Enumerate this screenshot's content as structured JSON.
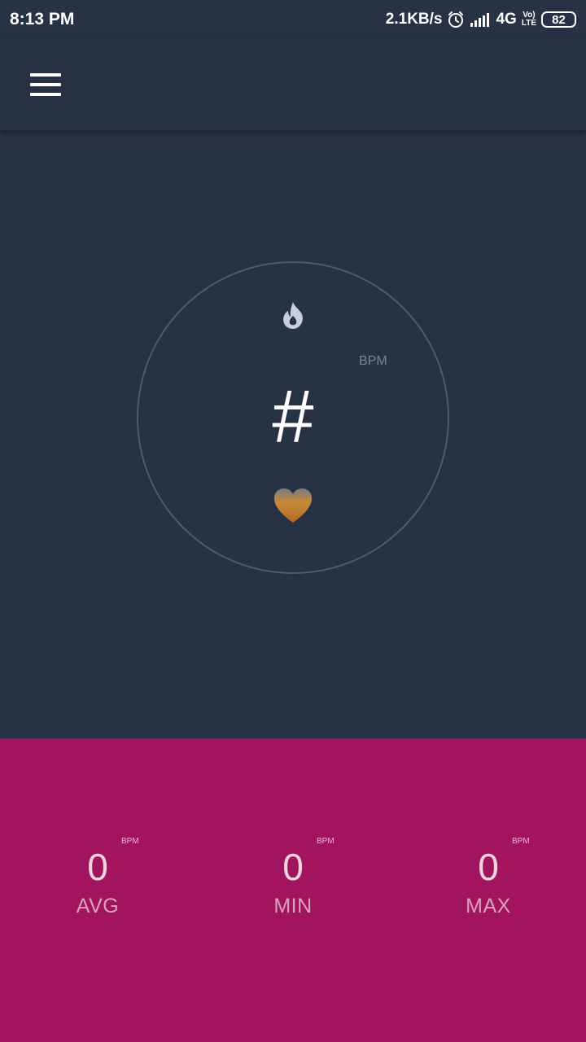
{
  "status_bar": {
    "time": "8:13 PM",
    "net_speed": "2.1KB/s",
    "network": "4G",
    "volte_top": "Vo)",
    "volte_bottom": "LTE",
    "battery": "82"
  },
  "app_bar": {
    "menu_icon": "hamburger-menu-icon"
  },
  "meter": {
    "value": "#",
    "unit": "BPM",
    "top_icon": "flame-icon",
    "bottom_icon": "heart-icon"
  },
  "stats": {
    "avg": {
      "value": "0",
      "unit": "BPM",
      "label": "AVG"
    },
    "min": {
      "value": "0",
      "unit": "BPM",
      "label": "MIN"
    },
    "max": {
      "value": "0",
      "unit": "BPM",
      "label": "MAX"
    }
  },
  "colors": {
    "background": "#283245",
    "stats_panel": "#a2155e",
    "circle_stroke": "#4f5a6c"
  }
}
